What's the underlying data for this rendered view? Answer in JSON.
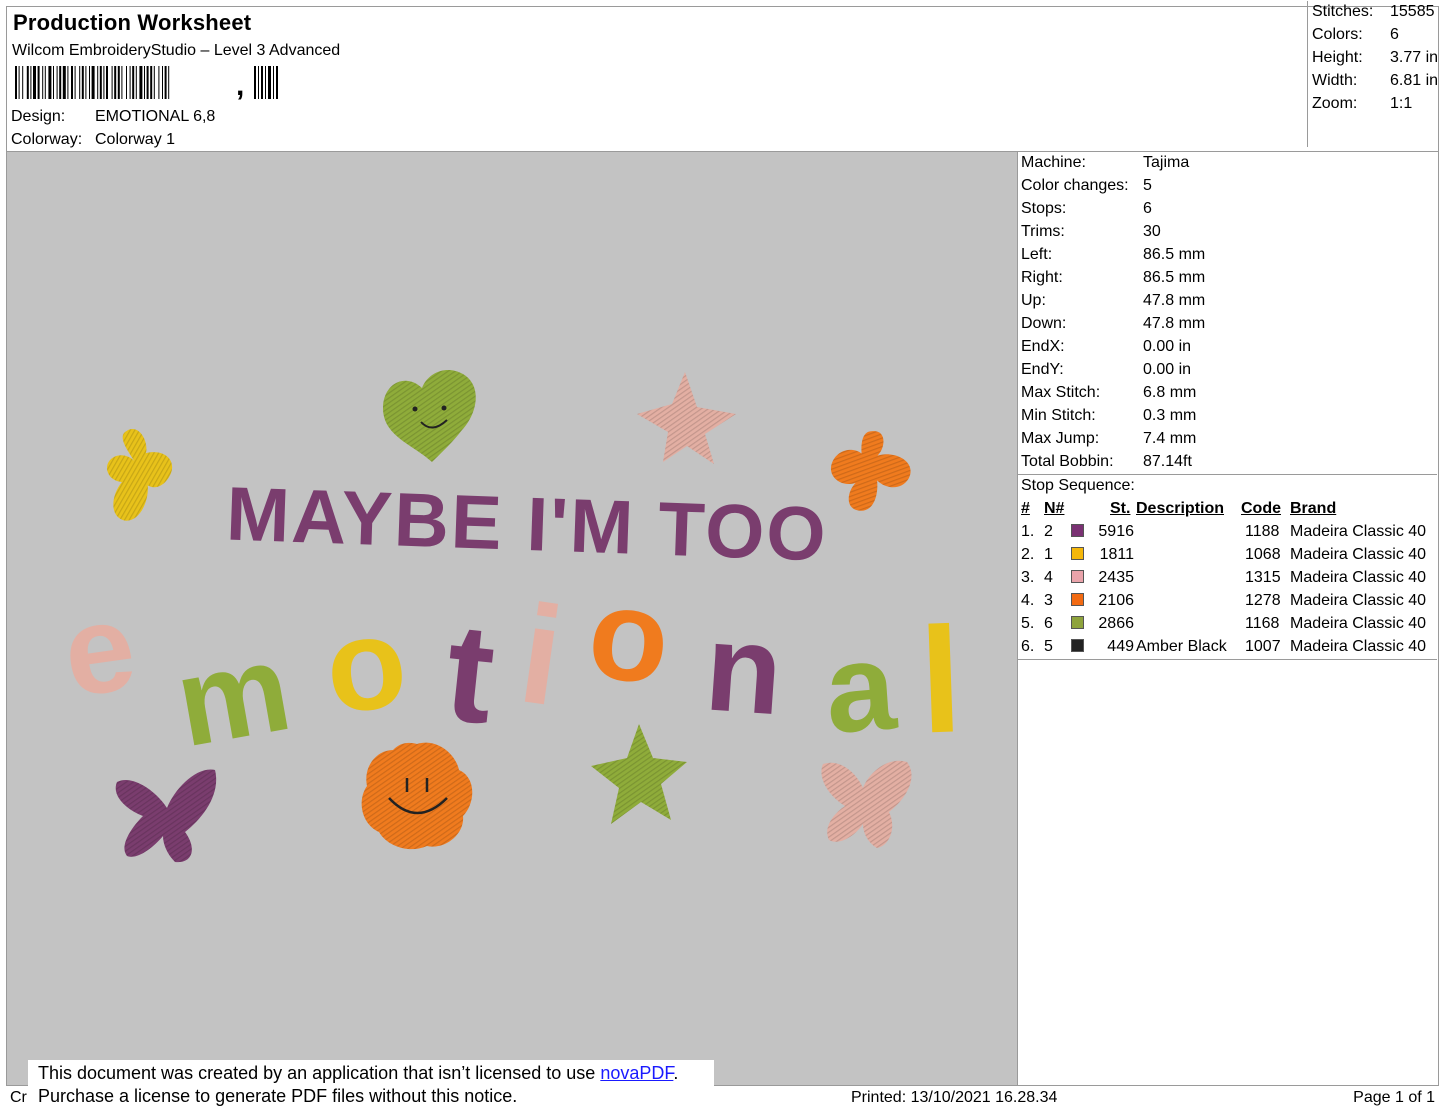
{
  "header": {
    "title": "Production Worksheet",
    "subtitle": "Wilcom EmbroideryStudio – Level 3 Advanced",
    "design_label": "Design:",
    "design_value": "EMOTIONAL 6,8",
    "colorway_label": "Colorway:",
    "colorway_value": "Colorway 1"
  },
  "stats": [
    {
      "label": "Stitches:",
      "value": "15585"
    },
    {
      "label": "Colors:",
      "value": "6"
    },
    {
      "label": "Height:",
      "value": "3.77 in"
    },
    {
      "label": "Width:",
      "value": "6.81 in"
    },
    {
      "label": "Zoom:",
      "value": "1:1"
    }
  ],
  "design": {
    "line1": "MAYBE I'M TOO",
    "line2": [
      "e",
      "m",
      "o",
      "t",
      "i",
      "o",
      "n",
      "a",
      "l"
    ],
    "colors": {
      "purple": "#7a3d6e",
      "yellow": "#e8c21a",
      "pink": "#e3afa3",
      "orange": "#f07b1e",
      "green": "#8fac3a",
      "black": "#222222"
    }
  },
  "machine_info": [
    {
      "label": "Machine:",
      "value": "Tajima"
    },
    {
      "label": "Color changes:",
      "value": "5"
    },
    {
      "label": "Stops:",
      "value": "6"
    },
    {
      "label": "Trims:",
      "value": "30"
    },
    {
      "label": "Left:",
      "value": "86.5 mm"
    },
    {
      "label": "Right:",
      "value": "86.5 mm"
    },
    {
      "label": "Up:",
      "value": "47.8 mm"
    },
    {
      "label": "Down:",
      "value": "47.8 mm"
    },
    {
      "label": "EndX:",
      "value": "0.00 in"
    },
    {
      "label": "EndY:",
      "value": "0.00 in"
    },
    {
      "label": "Max Stitch:",
      "value": "6.8 mm"
    },
    {
      "label": "Min Stitch:",
      "value": "0.3 mm"
    },
    {
      "label": "Max Jump:",
      "value": "7.4 mm"
    },
    {
      "label": "Total Bobbin:",
      "value": "87.14ft"
    }
  ],
  "stop_sequence": {
    "title": "Stop Sequence:",
    "headers": {
      "num": "#",
      "n": "N#",
      "st": "St.",
      "desc": "Description",
      "code": "Code",
      "brand": "Brand"
    },
    "rows": [
      {
        "num": "1.",
        "n": "2",
        "color": "#7a3173",
        "st": "5916",
        "desc": "",
        "code": "1188",
        "brand": "Madeira Classic 40"
      },
      {
        "num": "2.",
        "n": "1",
        "color": "#f5b70a",
        "st": "1811",
        "desc": "",
        "code": "1068",
        "brand": "Madeira Classic 40"
      },
      {
        "num": "3.",
        "n": "4",
        "color": "#e9a3aa",
        "st": "2435",
        "desc": "",
        "code": "1315",
        "brand": "Madeira Classic 40"
      },
      {
        "num": "4.",
        "n": "3",
        "color": "#f26a12",
        "st": "2106",
        "desc": "",
        "code": "1278",
        "brand": "Madeira Classic 40"
      },
      {
        "num": "5.",
        "n": "6",
        "color": "#8ea33c",
        "st": "2866",
        "desc": "",
        "code": "1168",
        "brand": "Madeira Classic 40"
      },
      {
        "num": "6.",
        "n": "5",
        "color": "#222222",
        "st": "449",
        "desc": "Amber Black",
        "code": "1007",
        "brand": "Madeira Classic 40"
      }
    ]
  },
  "footer": {
    "left_fragment": "Cr",
    "printed": "Printed: 13/10/2021 16.28.34",
    "page": "Page 1 of 1"
  },
  "notice": {
    "line1_pre": "This document was created by an application that isn’t licensed to use ",
    "link": "novaPDF",
    "line1_post": ".",
    "line2": "Purchase a license to generate PDF files without this notice."
  }
}
